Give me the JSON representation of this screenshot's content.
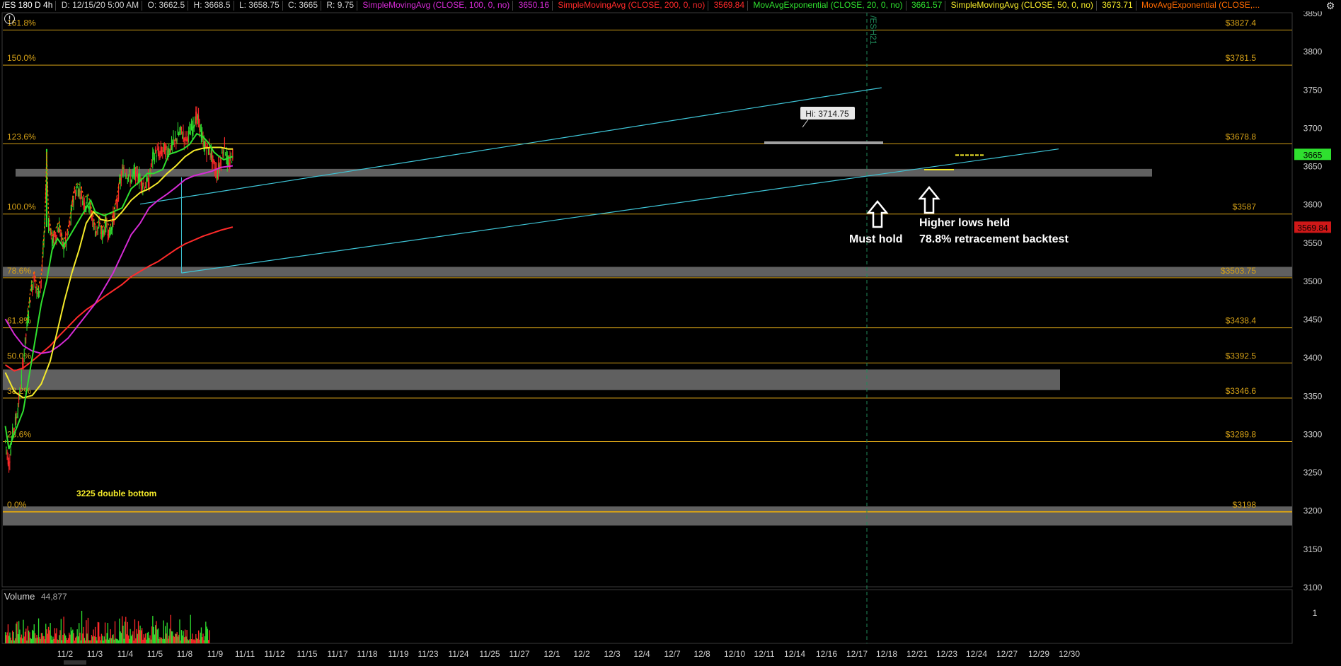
{
  "header": {
    "symbol": "/ES 180 D 4h",
    "date": "D: 12/15/20 5:00 AM",
    "open": "O: 3662.5",
    "high": "H: 3668.5",
    "low": "L: 3658.75",
    "close": "C: 3665",
    "range": "R: 9.75",
    "studies": [
      {
        "label": "SimpleMovingAvg (CLOSE, 100, 0, no)",
        "value": "3650.16",
        "color": "#d62bd6"
      },
      {
        "label": "SimpleMovingAvg (CLOSE, 200, 0, no)",
        "value": "3569.84",
        "color": "#ff2a2a"
      },
      {
        "label": "MovAvgExponential (CLOSE, 20, 0, no)",
        "value": "3661.57",
        "color": "#2fe02f"
      },
      {
        "label": "SimpleMovingAvg (CLOSE, 50, 0, no)",
        "value": "3673.71",
        "color": "#f5ea2a"
      },
      {
        "label": "MovAvgExponential (CLOSE,...",
        "value": "",
        "color": "#ff6a00"
      }
    ]
  },
  "volume_panel": {
    "label": "Volume",
    "value": "44,877"
  },
  "colors": {
    "ema20": "#2fe02f",
    "sma50": "#f5ea2a",
    "sma100": "#d62bd6",
    "sma200": "#ff2a2a",
    "fib": "#d4a017",
    "channel": "#3fc6d8",
    "zone": "#808080",
    "up": "#2fe02f",
    "down": "#ff2a2a"
  },
  "chart_data": {
    "type": "candlestick",
    "y_axis": {
      "min": 3100,
      "max": 3850,
      "ticks": [
        3100,
        3150,
        3200,
        3250,
        3300,
        3350,
        3400,
        3450,
        3500,
        3550,
        3600,
        3650,
        3700,
        3750,
        3800,
        3850
      ]
    },
    "x_ticks": [
      "11/2",
      "11/3",
      "11/4",
      "11/5",
      "11/8",
      "11/9",
      "11/11",
      "11/12",
      "11/15",
      "11/17",
      "11/18",
      "11/19",
      "11/23",
      "11/24",
      "11/25",
      "11/27",
      "12/1",
      "12/2",
      "12/3",
      "12/4",
      "12/7",
      "12/8",
      "12/10",
      "12/11",
      "12/14",
      "12/16",
      "12/17",
      "12/18",
      "12/21",
      "12/23",
      "12/24",
      "12/27",
      "12/29",
      "12/30"
    ],
    "fib_levels": [
      {
        "pct": "161.8%",
        "price": 3827.4,
        "label": "$3827.4"
      },
      {
        "pct": "150.0%",
        "price": 3781.5,
        "label": "$3781.5"
      },
      {
        "pct": "123.6%",
        "price": 3678.8,
        "label": "$3678.8"
      },
      {
        "pct": "100.0%",
        "price": 3587,
        "label": "$3587"
      },
      {
        "pct": "78.6%",
        "price": 3503.75,
        "label": "$3503.75"
      },
      {
        "pct": "61.8%",
        "price": 3438.4,
        "label": "$3438.4"
      },
      {
        "pct": "50.0%",
        "price": 3392.5,
        "label": "$3392.5"
      },
      {
        "pct": "38.2%",
        "price": 3346.6,
        "label": "$3346.6"
      },
      {
        "pct": "23.6%",
        "price": 3289.8,
        "label": "$3289.8"
      },
      {
        "pct": "0.0%",
        "price": 3198,
        "label": "$3198"
      }
    ],
    "price_labels": [
      {
        "text": "3665",
        "price": 3665,
        "bg": "#2fe02f",
        "fg": "#000"
      },
      {
        "text": "3569.84",
        "price": 3569.84,
        "bg": "#d01818",
        "fg": "#000"
      }
    ],
    "support_zones": [
      {
        "from": 3636,
        "to": 3646
      },
      {
        "from": 3505,
        "to": 3518
      },
      {
        "from": 3357,
        "to": 3384
      },
      {
        "from": 3180,
        "to": 3205
      }
    ],
    "annotations": {
      "high_label": "Hi: 3714.75",
      "double_bottom": "3225 double bottom",
      "must_hold": "Must hold",
      "higher_lows_1": "Higher lows held",
      "higher_lows_2": "78.8% retracement backtest",
      "contract_marker": "/ESH21"
    },
    "series_names": [
      "EMA 20",
      "SMA 50",
      "SMA 100",
      "SMA 200"
    ],
    "ema20": [
      [
        0,
        3310
      ],
      [
        4,
        3280
      ],
      [
        10,
        3300
      ],
      [
        20,
        3330
      ],
      [
        30,
        3400
      ],
      [
        40,
        3470
      ],
      [
        46,
        3500
      ],
      [
        52,
        3540
      ],
      [
        58,
        3555
      ],
      [
        64,
        3545
      ],
      [
        70,
        3555
      ],
      [
        80,
        3575
      ],
      [
        90,
        3595
      ],
      [
        95,
        3605
      ],
      [
        100,
        3590
      ],
      [
        110,
        3585
      ],
      [
        120,
        3590
      ],
      [
        130,
        3595
      ],
      [
        140,
        3620
      ],
      [
        150,
        3630
      ],
      [
        158,
        3640
      ],
      [
        165,
        3640
      ],
      [
        175,
        3645
      ],
      [
        182,
        3665
      ],
      [
        190,
        3668
      ],
      [
        198,
        3672
      ],
      [
        205,
        3678
      ],
      [
        213,
        3692
      ],
      [
        220,
        3688
      ],
      [
        226,
        3680
      ],
      [
        232,
        3668
      ],
      [
        238,
        3662
      ],
      [
        243,
        3658
      ],
      [
        248,
        3660
      ],
      [
        253,
        3662
      ]
    ],
    "sma50": [
      [
        0,
        3380
      ],
      [
        10,
        3355
      ],
      [
        20,
        3347
      ],
      [
        30,
        3350
      ],
      [
        40,
        3365
      ],
      [
        50,
        3395
      ],
      [
        58,
        3435
      ],
      [
        66,
        3475
      ],
      [
        74,
        3510
      ],
      [
        82,
        3540
      ],
      [
        90,
        3575
      ],
      [
        98,
        3590
      ],
      [
        106,
        3580
      ],
      [
        114,
        3578
      ],
      [
        122,
        3580
      ],
      [
        130,
        3590
      ],
      [
        140,
        3605
      ],
      [
        150,
        3615
      ],
      [
        160,
        3620
      ],
      [
        170,
        3628
      ],
      [
        180,
        3640
      ],
      [
        190,
        3650
      ],
      [
        200,
        3662
      ],
      [
        210,
        3670
      ],
      [
        220,
        3673
      ],
      [
        230,
        3674
      ],
      [
        240,
        3674
      ],
      [
        248,
        3672
      ],
      [
        253,
        3672
      ]
    ],
    "sma100": [
      [
        0,
        3450
      ],
      [
        10,
        3430
      ],
      [
        20,
        3415
      ],
      [
        30,
        3408
      ],
      [
        40,
        3405
      ],
      [
        50,
        3407
      ],
      [
        60,
        3415
      ],
      [
        70,
        3425
      ],
      [
        80,
        3440
      ],
      [
        90,
        3455
      ],
      [
        100,
        3470
      ],
      [
        110,
        3490
      ],
      [
        120,
        3510
      ],
      [
        130,
        3535
      ],
      [
        140,
        3560
      ],
      [
        150,
        3575
      ],
      [
        160,
        3595
      ],
      [
        170,
        3605
      ],
      [
        180,
        3613
      ],
      [
        190,
        3622
      ],
      [
        200,
        3632
      ],
      [
        210,
        3637
      ],
      [
        220,
        3640
      ],
      [
        230,
        3643
      ],
      [
        240,
        3648
      ],
      [
        253,
        3650
      ]
    ],
    "sma200": [
      [
        0,
        3390
      ],
      [
        10,
        3382
      ],
      [
        20,
        3386
      ],
      [
        30,
        3395
      ],
      [
        40,
        3405
      ],
      [
        50,
        3415
      ],
      [
        60,
        3428
      ],
      [
        70,
        3440
      ],
      [
        80,
        3452
      ],
      [
        90,
        3462
      ],
      [
        100,
        3470
      ],
      [
        110,
        3479
      ],
      [
        120,
        3487
      ],
      [
        130,
        3495
      ],
      [
        140,
        3505
      ],
      [
        150,
        3512
      ],
      [
        160,
        3519
      ],
      [
        170,
        3525
      ],
      [
        180,
        3533
      ],
      [
        190,
        3541
      ],
      [
        200,
        3548
      ],
      [
        210,
        3553
      ],
      [
        220,
        3558
      ],
      [
        230,
        3562
      ],
      [
        240,
        3566
      ],
      [
        253,
        3570
      ]
    ],
    "price_path": [
      [
        0,
        3290
      ],
      [
        4,
        3260
      ],
      [
        8,
        3300
      ],
      [
        12,
        3320
      ],
      [
        16,
        3350
      ],
      [
        20,
        3395
      ],
      [
        24,
        3440
      ],
      [
        28,
        3480
      ],
      [
        32,
        3505
      ],
      [
        36,
        3480
      ],
      [
        40,
        3500
      ],
      [
        44,
        3570
      ],
      [
        46,
        3660
      ],
      [
        48,
        3580
      ],
      [
        52,
        3550
      ],
      [
        56,
        3560
      ],
      [
        60,
        3570
      ],
      [
        64,
        3545
      ],
      [
        68,
        3550
      ],
      [
        72,
        3575
      ],
      [
        76,
        3610
      ],
      [
        80,
        3620
      ],
      [
        84,
        3615
      ],
      [
        88,
        3600
      ],
      [
        92,
        3605
      ],
      [
        96,
        3585
      ],
      [
        100,
        3565
      ],
      [
        104,
        3570
      ],
      [
        108,
        3560
      ],
      [
        112,
        3575
      ],
      [
        116,
        3560
      ],
      [
        120,
        3580
      ],
      [
        124,
        3600
      ],
      [
        128,
        3630
      ],
      [
        132,
        3648
      ],
      [
        136,
        3640
      ],
      [
        140,
        3632
      ],
      [
        144,
        3640
      ],
      [
        148,
        3637
      ],
      [
        152,
        3628
      ],
      [
        156,
        3625
      ],
      [
        160,
        3630
      ],
      [
        164,
        3660
      ],
      [
        168,
        3668
      ],
      [
        172,
        3665
      ],
      [
        176,
        3672
      ],
      [
        180,
        3668
      ],
      [
        184,
        3675
      ],
      [
        188,
        3680
      ],
      [
        192,
        3690
      ],
      [
        196,
        3695
      ],
      [
        200,
        3685
      ],
      [
        204,
        3690
      ],
      [
        208,
        3700
      ],
      [
        212,
        3714
      ],
      [
        216,
        3705
      ],
      [
        220,
        3680
      ],
      [
        224,
        3672
      ],
      [
        228,
        3670
      ],
      [
        232,
        3650
      ],
      [
        236,
        3640
      ],
      [
        240,
        3660
      ],
      [
        244,
        3678
      ],
      [
        248,
        3648
      ],
      [
        251,
        3658
      ],
      [
        253,
        3665
      ]
    ],
    "volume_max_label": "1"
  }
}
